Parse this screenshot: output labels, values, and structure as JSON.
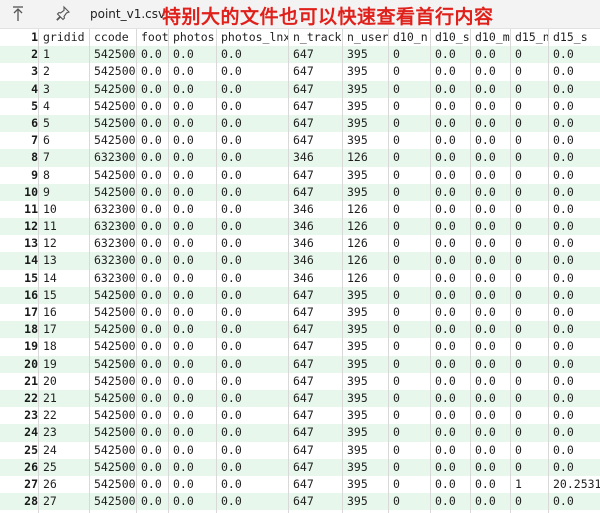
{
  "titlebar": {
    "pin_icon_glyph": "↑",
    "tab_title": "point_v1.csv",
    "banner": "特别大的文件也可以快速查看首行内容",
    "banner_color": "#e0201b"
  },
  "table": {
    "columns": [
      "gridid",
      "ccode",
      "foot",
      "photos",
      "photos_lnx",
      "n_track",
      "n_user",
      "d10_n",
      "d10_s",
      "d10_m",
      "d15_n",
      "d15_s"
    ],
    "header_row_number": "1",
    "rows": [
      {
        "n": "2",
        "c": [
          "1",
          "542500",
          "0.0",
          "0.0",
          "0.0",
          "647",
          "395",
          "0",
          "0.0",
          "0.0",
          "0",
          "0.0"
        ]
      },
      {
        "n": "3",
        "c": [
          "2",
          "542500",
          "0.0",
          "0.0",
          "0.0",
          "647",
          "395",
          "0",
          "0.0",
          "0.0",
          "0",
          "0.0"
        ]
      },
      {
        "n": "4",
        "c": [
          "3",
          "542500",
          "0.0",
          "0.0",
          "0.0",
          "647",
          "395",
          "0",
          "0.0",
          "0.0",
          "0",
          "0.0"
        ]
      },
      {
        "n": "5",
        "c": [
          "4",
          "542500",
          "0.0",
          "0.0",
          "0.0",
          "647",
          "395",
          "0",
          "0.0",
          "0.0",
          "0",
          "0.0"
        ]
      },
      {
        "n": "6",
        "c": [
          "5",
          "542500",
          "0.0",
          "0.0",
          "0.0",
          "647",
          "395",
          "0",
          "0.0",
          "0.0",
          "0",
          "0.0"
        ]
      },
      {
        "n": "7",
        "c": [
          "6",
          "542500",
          "0.0",
          "0.0",
          "0.0",
          "647",
          "395",
          "0",
          "0.0",
          "0.0",
          "0",
          "0.0"
        ]
      },
      {
        "n": "8",
        "c": [
          "7",
          "632300",
          "0.0",
          "0.0",
          "0.0",
          "346",
          "126",
          "0",
          "0.0",
          "0.0",
          "0",
          "0.0"
        ]
      },
      {
        "n": "9",
        "c": [
          "8",
          "542500",
          "0.0",
          "0.0",
          "0.0",
          "647",
          "395",
          "0",
          "0.0",
          "0.0",
          "0",
          "0.0"
        ]
      },
      {
        "n": "10",
        "c": [
          "9",
          "542500",
          "0.0",
          "0.0",
          "0.0",
          "647",
          "395",
          "0",
          "0.0",
          "0.0",
          "0",
          "0.0"
        ]
      },
      {
        "n": "11",
        "c": [
          "10",
          "632300",
          "0.0",
          "0.0",
          "0.0",
          "346",
          "126",
          "0",
          "0.0",
          "0.0",
          "0",
          "0.0"
        ]
      },
      {
        "n": "12",
        "c": [
          "11",
          "632300",
          "0.0",
          "0.0",
          "0.0",
          "346",
          "126",
          "0",
          "0.0",
          "0.0",
          "0",
          "0.0"
        ]
      },
      {
        "n": "13",
        "c": [
          "12",
          "632300",
          "0.0",
          "0.0",
          "0.0",
          "346",
          "126",
          "0",
          "0.0",
          "0.0",
          "0",
          "0.0"
        ]
      },
      {
        "n": "14",
        "c": [
          "13",
          "632300",
          "0.0",
          "0.0",
          "0.0",
          "346",
          "126",
          "0",
          "0.0",
          "0.0",
          "0",
          "0.0"
        ]
      },
      {
        "n": "15",
        "c": [
          "14",
          "632300",
          "0.0",
          "0.0",
          "0.0",
          "346",
          "126",
          "0",
          "0.0",
          "0.0",
          "0",
          "0.0"
        ]
      },
      {
        "n": "16",
        "c": [
          "15",
          "542500",
          "0.0",
          "0.0",
          "0.0",
          "647",
          "395",
          "0",
          "0.0",
          "0.0",
          "0",
          "0.0"
        ]
      },
      {
        "n": "17",
        "c": [
          "16",
          "542500",
          "0.0",
          "0.0",
          "0.0",
          "647",
          "395",
          "0",
          "0.0",
          "0.0",
          "0",
          "0.0"
        ]
      },
      {
        "n": "18",
        "c": [
          "17",
          "542500",
          "0.0",
          "0.0",
          "0.0",
          "647",
          "395",
          "0",
          "0.0",
          "0.0",
          "0",
          "0.0"
        ]
      },
      {
        "n": "19",
        "c": [
          "18",
          "542500",
          "0.0",
          "0.0",
          "0.0",
          "647",
          "395",
          "0",
          "0.0",
          "0.0",
          "0",
          "0.0"
        ]
      },
      {
        "n": "20",
        "c": [
          "19",
          "542500",
          "0.0",
          "0.0",
          "0.0",
          "647",
          "395",
          "0",
          "0.0",
          "0.0",
          "0",
          "0.0"
        ]
      },
      {
        "n": "21",
        "c": [
          "20",
          "542500",
          "0.0",
          "0.0",
          "0.0",
          "647",
          "395",
          "0",
          "0.0",
          "0.0",
          "0",
          "0.0"
        ]
      },
      {
        "n": "22",
        "c": [
          "21",
          "542500",
          "0.0",
          "0.0",
          "0.0",
          "647",
          "395",
          "0",
          "0.0",
          "0.0",
          "0",
          "0.0"
        ]
      },
      {
        "n": "23",
        "c": [
          "22",
          "542500",
          "0.0",
          "0.0",
          "0.0",
          "647",
          "395",
          "0",
          "0.0",
          "0.0",
          "0",
          "0.0"
        ]
      },
      {
        "n": "24",
        "c": [
          "23",
          "542500",
          "0.0",
          "0.0",
          "0.0",
          "647",
          "395",
          "0",
          "0.0",
          "0.0",
          "0",
          "0.0"
        ]
      },
      {
        "n": "25",
        "c": [
          "24",
          "542500",
          "0.0",
          "0.0",
          "0.0",
          "647",
          "395",
          "0",
          "0.0",
          "0.0",
          "0",
          "0.0"
        ]
      },
      {
        "n": "26",
        "c": [
          "25",
          "542500",
          "0.0",
          "0.0",
          "0.0",
          "647",
          "395",
          "0",
          "0.0",
          "0.0",
          "0",
          "0.0"
        ]
      },
      {
        "n": "27",
        "c": [
          "26",
          "542500",
          "0.0",
          "0.0",
          "0.0",
          "647",
          "395",
          "0",
          "0.0",
          "0.0",
          "1",
          "20.2531"
        ]
      },
      {
        "n": "28",
        "c": [
          "27",
          "542500",
          "0.0",
          "0.0",
          "0.0",
          "647",
          "395",
          "0",
          "0.0",
          "0.0",
          "0",
          "0.0"
        ]
      },
      {
        "n": "29",
        "c": [
          "28",
          "542500",
          "0.0",
          "0.0",
          "0.0",
          "647",
          "395",
          "0",
          "0.0",
          "0.0",
          "0",
          "0.0"
        ]
      }
    ]
  },
  "colors": {
    "alt_row_bg": "#e7f7ec",
    "header_bg": "#ffffff"
  }
}
